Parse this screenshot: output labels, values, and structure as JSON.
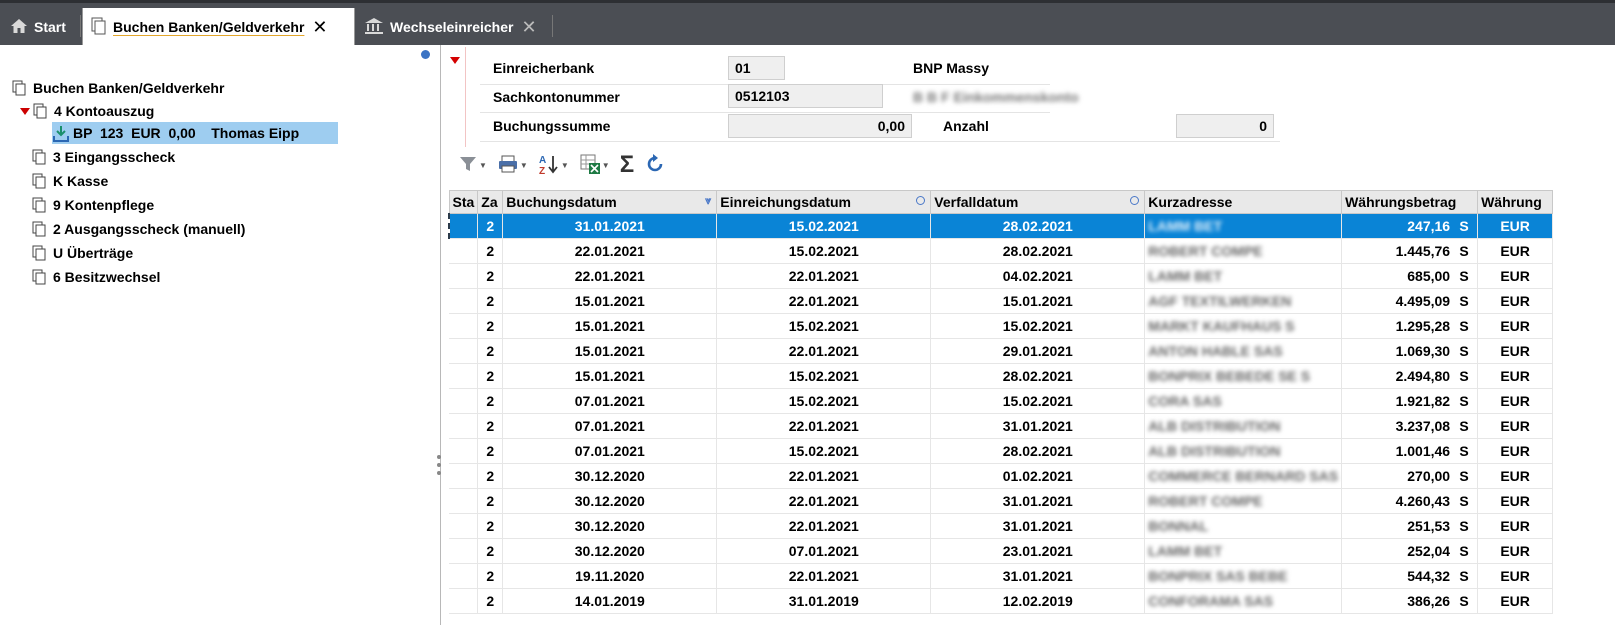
{
  "tabs": [
    {
      "label": "Start",
      "icon": "home-icon"
    },
    {
      "label": "Buchen Banken/Geldverkehr",
      "icon": "document-icon",
      "close": "✕"
    },
    {
      "label": "Wechseleinreicher",
      "icon": "bank-icon",
      "close": "✕"
    }
  ],
  "tree": {
    "root": "Buchen Banken/Geldverkehr",
    "items": [
      {
        "label": "4 Kontoauszug"
      },
      {
        "label": "BP  123  EUR  0,00    Thomas Eipp"
      },
      {
        "label": "3 Eingangsscheck"
      },
      {
        "label": "K Kasse"
      },
      {
        "label": "9 Kontenpflege"
      },
      {
        "label": "2 Ausgangsscheck (manuell)"
      },
      {
        "label": "U Überträge"
      },
      {
        "label": "6 Besitzwechsel"
      }
    ]
  },
  "form": {
    "einreicherbank_label": "Einreicherbank",
    "einreicherbank_value": "01",
    "bank_name": "BNP Massy",
    "sachkonto_label": "Sachkontonummer",
    "sachkonto_value": "0512103",
    "sachkonto_name": "B B F Einkommenskonto",
    "buchungssumme_label": "Buchungssumme",
    "buchungssumme_value": "0,00",
    "anzahl_label": "Anzahl",
    "anzahl_value": "0"
  },
  "toolbar": {
    "icons": [
      "filter-icon",
      "print-icon",
      "sort-az-icon",
      "export-excel-icon",
      "sum-icon",
      "refresh-icon"
    ],
    "sum_glyph": "Σ"
  },
  "table": {
    "columns": [
      "Sta",
      "Za",
      "Buchungsdatum",
      "Einreichungsdatum",
      "Verfalldatum",
      "Kurzadresse",
      "Währungsbetrag",
      "Währung"
    ],
    "rows": [
      {
        "za": "2",
        "buchung": "31.01.2021",
        "einreichung": "15.02.2021",
        "verfall": "28.02.2021",
        "kurz": "LAMM BET",
        "betrag": "247,16",
        "sh": "S",
        "waehrung": "EUR"
      },
      {
        "za": "2",
        "buchung": "22.01.2021",
        "einreichung": "15.02.2021",
        "verfall": "28.02.2021",
        "kurz": "ROBERT COMPE",
        "betrag": "1.445,76",
        "sh": "S",
        "waehrung": "EUR"
      },
      {
        "za": "2",
        "buchung": "22.01.2021",
        "einreichung": "22.01.2021",
        "verfall": "04.02.2021",
        "kurz": "LAMM BET",
        "betrag": "685,00",
        "sh": "S",
        "waehrung": "EUR"
      },
      {
        "za": "2",
        "buchung": "15.01.2021",
        "einreichung": "22.01.2021",
        "verfall": "15.01.2021",
        "kurz": "AGF TEXTILWERKEN",
        "betrag": "4.495,09",
        "sh": "S",
        "waehrung": "EUR"
      },
      {
        "za": "2",
        "buchung": "15.01.2021",
        "einreichung": "15.02.2021",
        "verfall": "15.02.2021",
        "kurz": "MARKT KAUFHAUS S",
        "betrag": "1.295,28",
        "sh": "S",
        "waehrung": "EUR"
      },
      {
        "za": "2",
        "buchung": "15.01.2021",
        "einreichung": "22.01.2021",
        "verfall": "29.01.2021",
        "kurz": "ANTON HABLE SAS",
        "betrag": "1.069,30",
        "sh": "S",
        "waehrung": "EUR"
      },
      {
        "za": "2",
        "buchung": "15.01.2021",
        "einreichung": "15.02.2021",
        "verfall": "28.02.2021",
        "kurz": "BONPRIX BEBEDE SE S",
        "betrag": "2.494,80",
        "sh": "S",
        "waehrung": "EUR"
      },
      {
        "za": "2",
        "buchung": "07.01.2021",
        "einreichung": "15.02.2021",
        "verfall": "15.02.2021",
        "kurz": "CORA SAS",
        "betrag": "1.921,82",
        "sh": "S",
        "waehrung": "EUR"
      },
      {
        "za": "2",
        "buchung": "07.01.2021",
        "einreichung": "22.01.2021",
        "verfall": "31.01.2021",
        "kurz": "ALB DISTRIBUTION",
        "betrag": "3.237,08",
        "sh": "S",
        "waehrung": "EUR"
      },
      {
        "za": "2",
        "buchung": "07.01.2021",
        "einreichung": "15.02.2021",
        "verfall": "28.02.2021",
        "kurz": "ALB DISTRIBUTION",
        "betrag": "1.001,46",
        "sh": "S",
        "waehrung": "EUR"
      },
      {
        "za": "2",
        "buchung": "30.12.2020",
        "einreichung": "22.01.2021",
        "verfall": "01.02.2021",
        "kurz": "COMMERCE BERNARD SAS",
        "betrag": "270,00",
        "sh": "S",
        "waehrung": "EUR"
      },
      {
        "za": "2",
        "buchung": "30.12.2020",
        "einreichung": "22.01.2021",
        "verfall": "31.01.2021",
        "kurz": "ROBERT COMPE",
        "betrag": "4.260,43",
        "sh": "S",
        "waehrung": "EUR"
      },
      {
        "za": "2",
        "buchung": "30.12.2020",
        "einreichung": "22.01.2021",
        "verfall": "31.01.2021",
        "kurz": "BONNAL",
        "betrag": "251,53",
        "sh": "S",
        "waehrung": "EUR"
      },
      {
        "za": "2",
        "buchung": "30.12.2020",
        "einreichung": "07.01.2021",
        "verfall": "23.01.2021",
        "kurz": "LAMM BET",
        "betrag": "252,04",
        "sh": "S",
        "waehrung": "EUR"
      },
      {
        "za": "2",
        "buchung": "19.11.2020",
        "einreichung": "22.01.2021",
        "verfall": "31.01.2021",
        "kurz": "BONPRIX SAS BEBE",
        "betrag": "544,32",
        "sh": "S",
        "waehrung": "EUR"
      },
      {
        "za": "2",
        "buchung": "14.01.2019",
        "einreichung": "31.01.2019",
        "verfall": "12.02.2019",
        "kurz": "CONFORAMA SAS",
        "betrag": "386,26",
        "sh": "S",
        "waehrung": "EUR"
      }
    ]
  }
}
